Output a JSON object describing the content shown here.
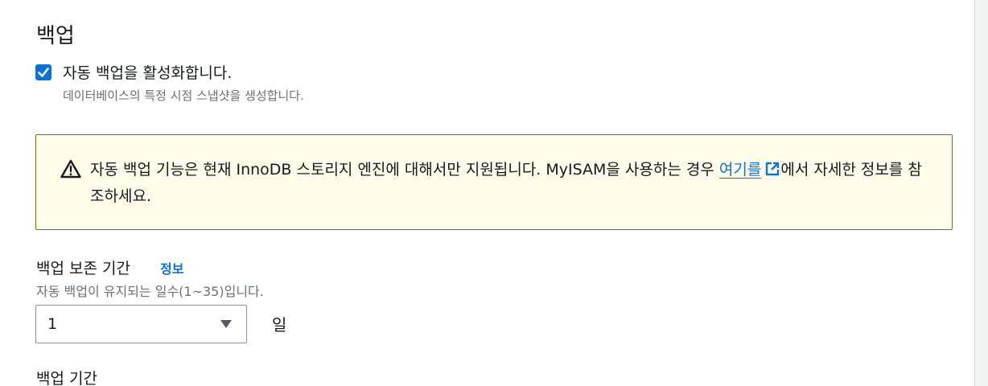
{
  "section": {
    "title": "백업"
  },
  "auto_backup": {
    "checked": true,
    "label": "자동 백업을 활성화합니다.",
    "description": "데이터베이스의 특정 시점 스냅샷을 생성합니다."
  },
  "alert": {
    "type": "warning",
    "icon": "warning-icon",
    "text_before": "자동 백업 기능은 현재 InnoDB 스토리지 엔진에 대해서만 지원됩니다. MyISAM을 사용하는 경우 ",
    "link_text": "여기를",
    "link_icon": "external-link-icon",
    "text_after": "에서 자세한 정보를 참조하세요."
  },
  "retention": {
    "label": "백업 보존 기간",
    "info_link": "정보",
    "description": "자동 백업이 유지되는 일수(1~35)입니다.",
    "selected_value": "1",
    "unit": "일"
  },
  "next_section": {
    "label": "백업 기간"
  },
  "colors": {
    "accent": "#0972d3",
    "warning_bg": "#fffce9",
    "warning_border": "#8d6605",
    "muted_text": "#687078"
  }
}
